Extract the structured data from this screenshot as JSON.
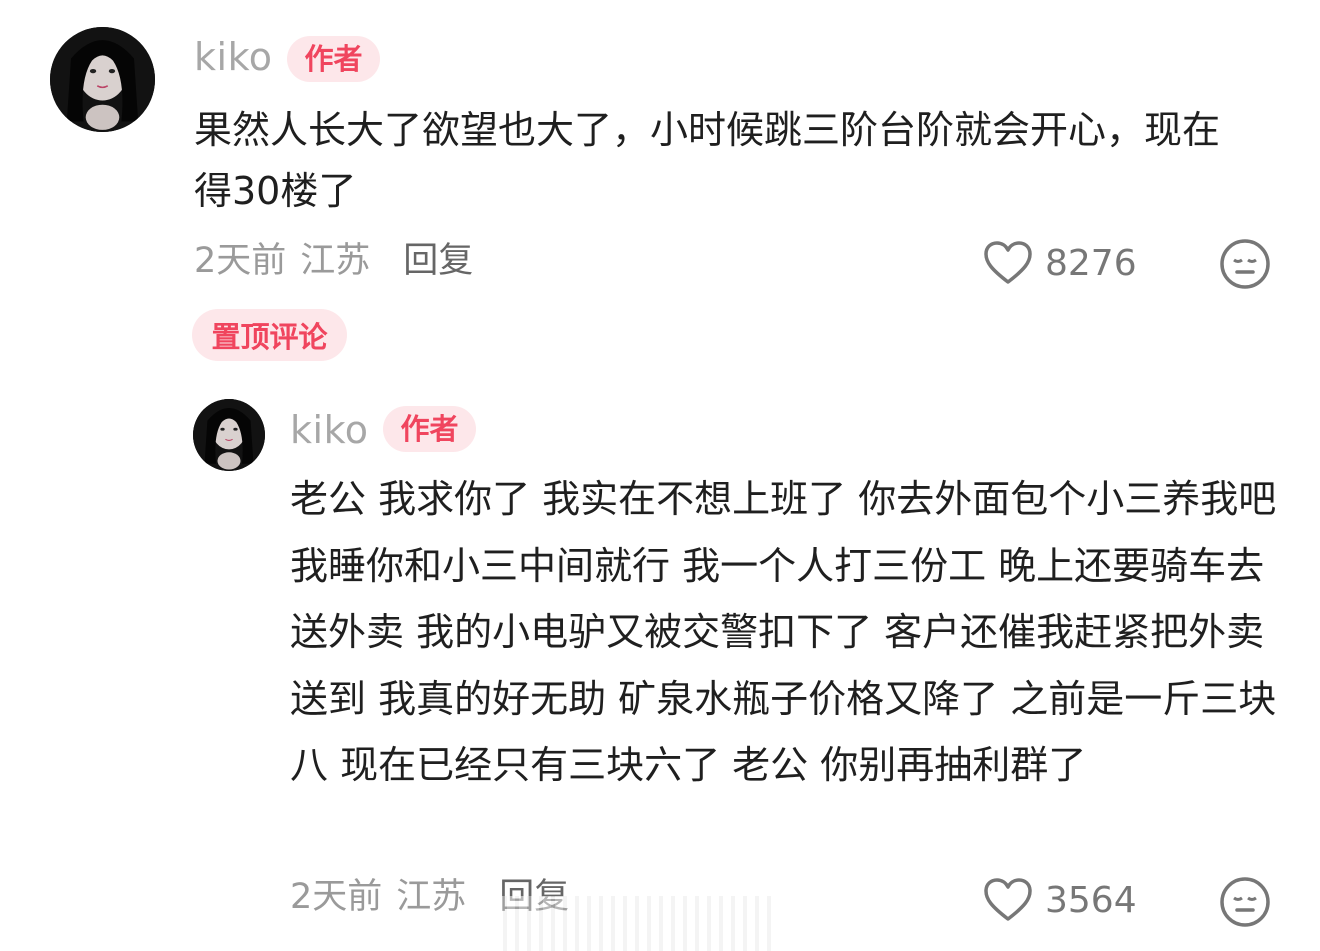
{
  "comments": [
    {
      "username": "kiko",
      "badge": "作者",
      "text": "果然人长大了欲望也大了，小时候跳三阶台阶就会开心，现在得30楼了",
      "time": "2天前",
      "location": "江苏",
      "reply_label": "回复",
      "likes": "8276"
    },
    {
      "username": "kiko",
      "badge": "作者",
      "text": "老公 我求你了 我实在不想上班了 你去外面包个小三养我吧 我睡你和小三中间就行 我一个人打三份工 晚上还要骑车去送外卖 我的小电驴又被交警扣下了 客户还催我赶紧把外卖送到 我真的好无助 矿泉水瓶子价格又降了 之前是一斤三块八 现在已经只有三块六了 老公 你别再抽利群了",
      "time": "2天前",
      "location": "江苏",
      "reply_label": "回复",
      "likes": "3564"
    }
  ],
  "pinned_label": "置顶评论",
  "icons": {
    "like": "heart-icon",
    "emoji": "meh-face-icon"
  },
  "colors": {
    "accent": "#f0455e",
    "badge_bg": "#fde7ea",
    "muted": "#a7a7a7"
  }
}
